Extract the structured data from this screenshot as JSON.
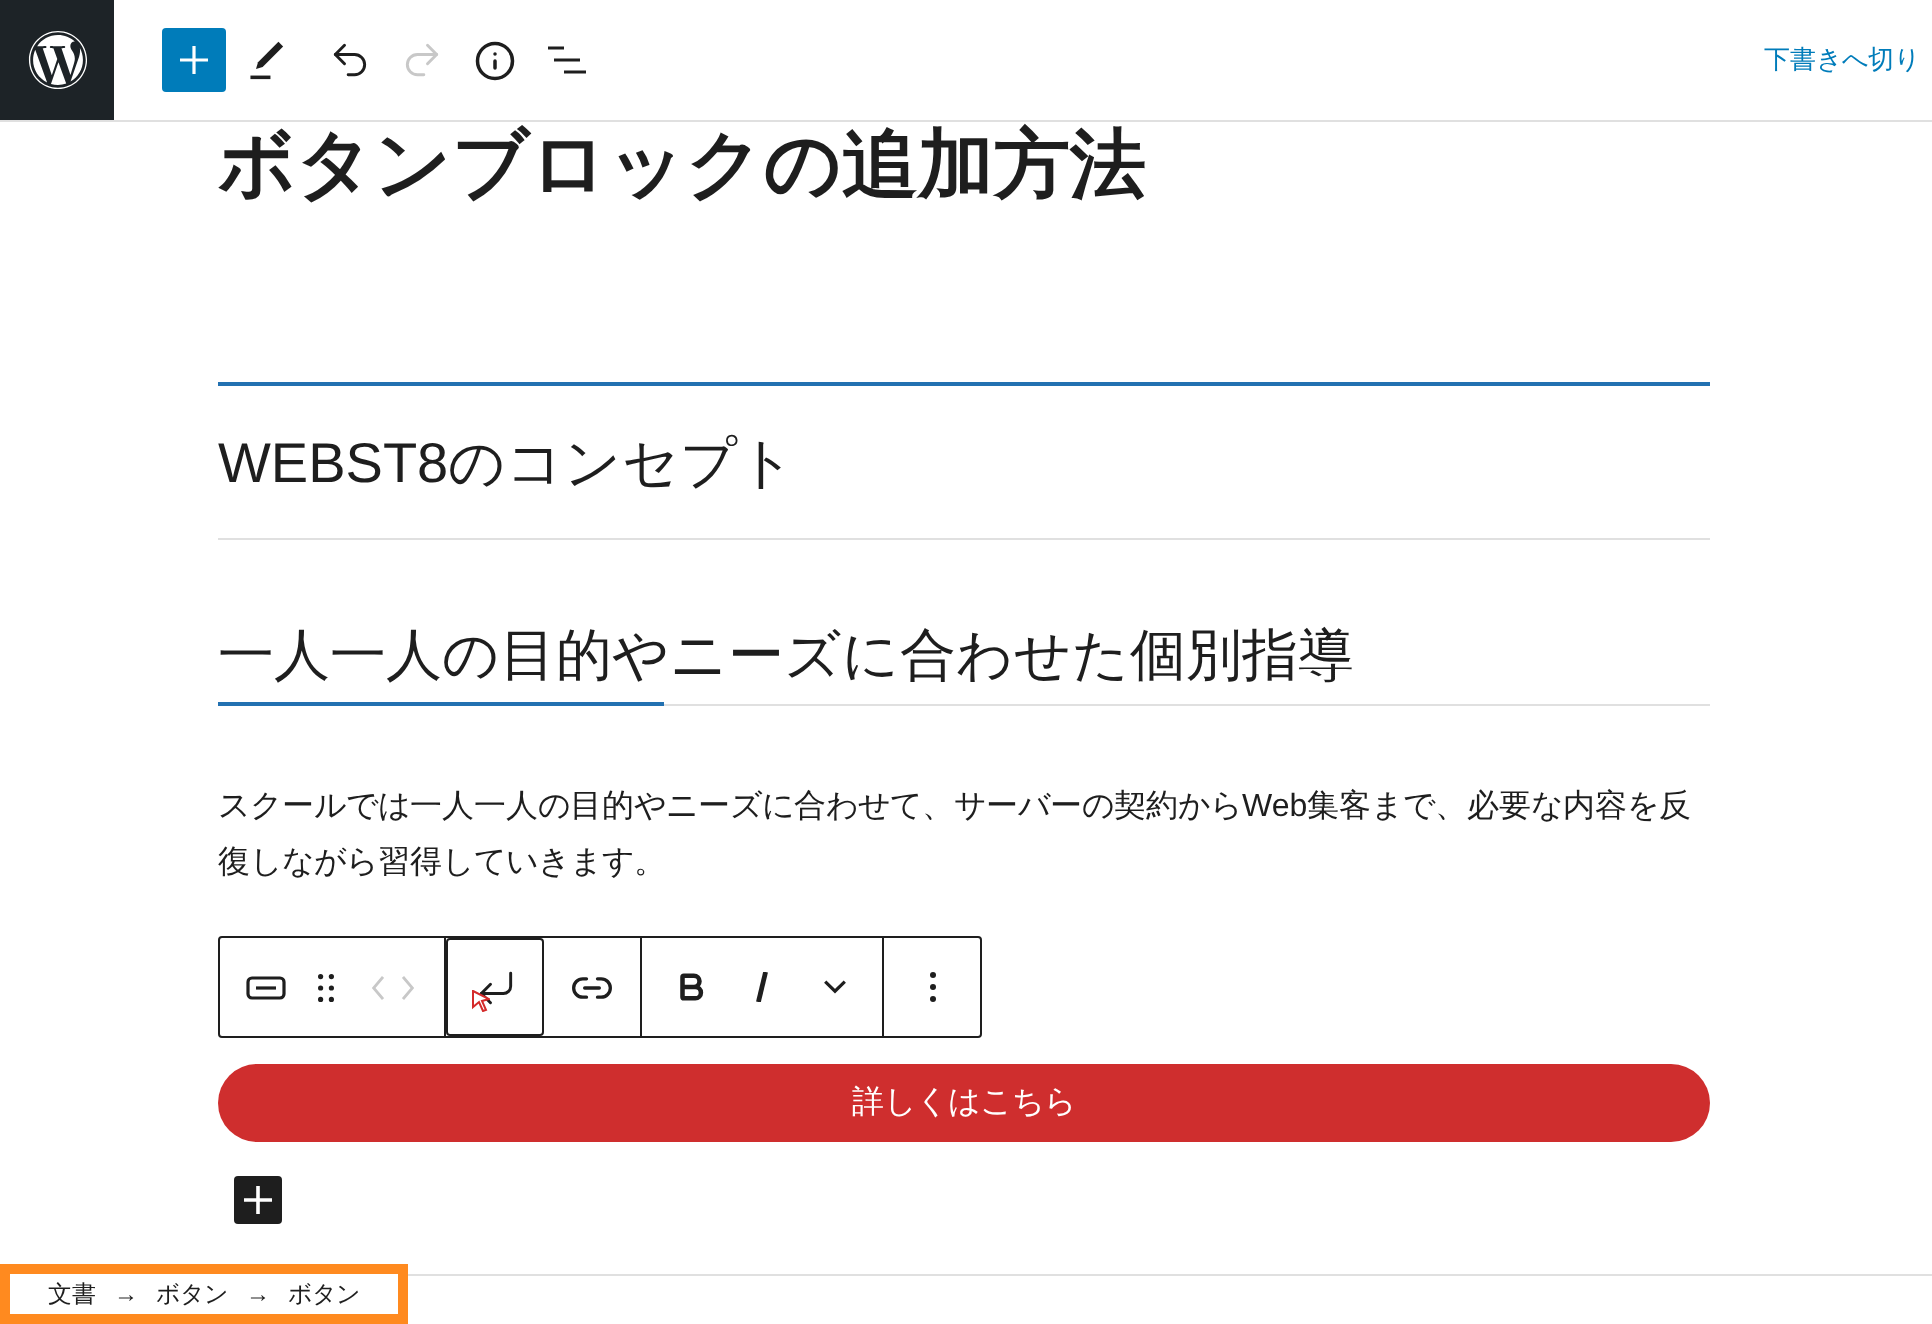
{
  "top_bar": {
    "tools": [
      {
        "kind": "inserter",
        "disabled": false
      },
      {
        "kind": "tools",
        "disabled": false
      },
      {
        "kind": "undo",
        "disabled": false
      },
      {
        "kind": "redo",
        "disabled": true
      },
      {
        "kind": "details",
        "disabled": false
      },
      {
        "kind": "list-view",
        "disabled": false
      }
    ],
    "switch_to_draft": "下書きへ切り"
  },
  "editor": {
    "title": "ボタンブロックの追加方法",
    "blocks": [
      {
        "kind": "heading-ruled",
        "text": "WEBST8のコンセプト"
      },
      {
        "kind": "heading-underlined",
        "text": "一人一人の目的やニーズに合わせた個別指導"
      },
      {
        "kind": "paragraph",
        "text": "スクールでは一人一人の目的やニーズに合わせて、サーバーの契約からWeb集客まで、必要な内容を反復しながら習得していきます。"
      },
      {
        "kind": "button",
        "text": "詳しくはこちら"
      }
    ],
    "block_toolbar": {
      "groups": [
        {
          "items": [
            {
              "kind": "block-type",
              "disabled": false,
              "focused": false
            },
            {
              "kind": "drag",
              "disabled": false,
              "focused": false
            },
            {
              "kind": "move",
              "disabled": true,
              "focused": false
            }
          ]
        },
        {
          "items": [
            {
              "kind": "return",
              "disabled": false,
              "focused": true
            },
            {
              "kind": "link",
              "disabled": false,
              "focused": false
            }
          ]
        },
        {
          "items": [
            {
              "kind": "bold",
              "disabled": false,
              "focused": false
            },
            {
              "kind": "italic",
              "disabled": false,
              "focused": false
            },
            {
              "kind": "more-rich",
              "disabled": false,
              "focused": false
            }
          ]
        },
        {
          "items": [
            {
              "kind": "options",
              "disabled": false,
              "focused": false
            }
          ]
        }
      ]
    }
  },
  "breadcrumb": {
    "highlighted": true,
    "items": [
      {
        "label": "文書"
      },
      {
        "separator": "→",
        "label": "ボタン"
      },
      {
        "separator": "→",
        "label": "ボタン"
      }
    ]
  }
}
